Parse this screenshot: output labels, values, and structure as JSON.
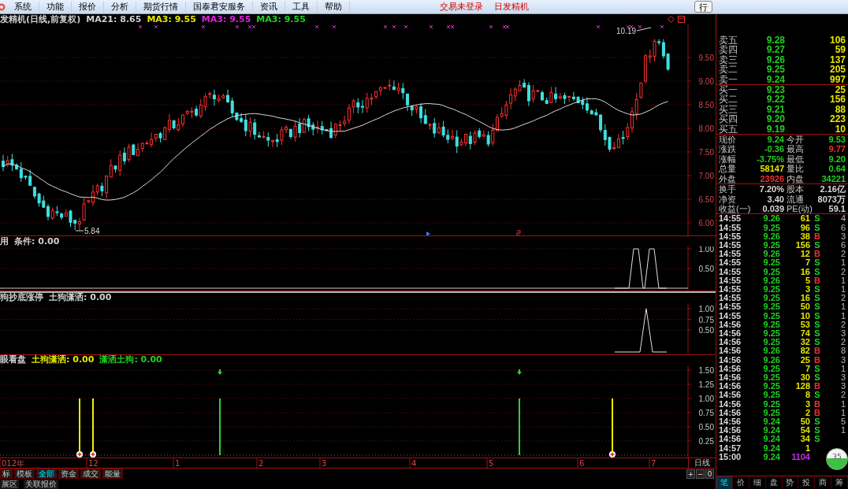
{
  "menu_bar": {
    "items": [
      "系统",
      "功能",
      "报价",
      "分析",
      "期货行情",
      "国泰君安服务",
      "资讯",
      "工具",
      "帮助"
    ],
    "status": [
      "交易未登录",
      "日发精机"
    ],
    "button": "行"
  },
  "main_chart": {
    "legend": [
      {
        "text": "发精机(日线,前复权)",
        "color": "#d0d0d0"
      },
      {
        "text": "MA21: 8.65",
        "color": "#d0d0d0"
      },
      {
        "text": "MA3: 9.55",
        "color": "#e6e600"
      },
      {
        "text": "MA3: 9.55",
        "color": "#e020e0"
      },
      {
        "text": "MA3: 9.55",
        "color": "#20d020"
      }
    ],
    "high_label": "10.19",
    "low_label": "5.84",
    "yticks": [
      "9.50",
      "9.00",
      "8.50",
      "8.00",
      "7.50",
      "7.00",
      "6.50",
      "6.00"
    ]
  },
  "indicator_panels": [
    {
      "legend": [
        {
          "text": "用",
          "color": "#d0d0d0"
        },
        {
          "text": "条件: 0.00",
          "color": "#d0d0d0"
        }
      ],
      "yticks": [
        "1.00",
        "0.50"
      ]
    },
    {
      "legend": [
        {
          "text": "狗抄底涨停",
          "color": "#d0d0d0"
        },
        {
          "text": "土狗潇洒: 0.00",
          "color": "#d0d0d0"
        }
      ],
      "yticks": [
        "1.00",
        "0.75",
        "0.50"
      ]
    },
    {
      "legend": [
        {
          "text": "眼看盘",
          "color": "#d0d0d0"
        },
        {
          "text": "土狗潇洒: 0.00",
          "color": "#e6e600"
        },
        {
          "text": "潇洒土狗: 0.00",
          "color": "#20d020"
        }
      ],
      "yticks": [
        "1.50",
        "1.25",
        "1.00",
        "0.75",
        "0.50",
        "0.25"
      ]
    }
  ],
  "date_axis": {
    "labels": [
      "012年",
      "12",
      "1",
      "2",
      "3",
      "4",
      "5",
      "6",
      "7"
    ],
    "period": "日线"
  },
  "bottom_tabs": [
    {
      "label": "标",
      "selected": false
    },
    {
      "label": "模板",
      "selected": false
    },
    {
      "label": "全部",
      "selected": true
    },
    {
      "label": "资金",
      "selected": false
    },
    {
      "label": "成交",
      "selected": false
    },
    {
      "label": "能量",
      "selected": false
    }
  ],
  "zoom_buttons": [
    "+",
    "−",
    "0"
  ],
  "bottom_links": [
    "展区",
    "关联报价"
  ],
  "order_book": {
    "asks": [
      {
        "label": "卖五",
        "price": "9.28",
        "volume": "106"
      },
      {
        "label": "卖四",
        "price": "9.27",
        "volume": "59"
      },
      {
        "label": "卖三",
        "price": "9.26",
        "volume": "137"
      },
      {
        "label": "卖二",
        "price": "9.25",
        "volume": "205"
      },
      {
        "label": "卖一",
        "price": "9.24",
        "volume": "997"
      }
    ],
    "bids": [
      {
        "label": "买一",
        "price": "9.23",
        "volume": "25"
      },
      {
        "label": "买二",
        "price": "9.22",
        "volume": "156"
      },
      {
        "label": "买三",
        "price": "9.21",
        "volume": "88"
      },
      {
        "label": "买四",
        "price": "9.20",
        "volume": "223"
      },
      {
        "label": "买五",
        "price": "9.19",
        "volume": "10"
      }
    ]
  },
  "quote": [
    {
      "label": "现价",
      "value": "9.24",
      "color": "#20d020"
    },
    {
      "label": "今开",
      "value": "9.53",
      "color": "#20d020"
    },
    {
      "label": "涨跌",
      "value": "-0.36",
      "color": "#20d020"
    },
    {
      "label": "最高",
      "value": "9.77",
      "color": "#f03030"
    },
    {
      "label": "涨幅",
      "value": "-3.75%",
      "color": "#20d020"
    },
    {
      "label": "最低",
      "value": "9.20",
      "color": "#20d020"
    },
    {
      "label": "总量",
      "value": "58147",
      "color": "#e6e600"
    },
    {
      "label": "量比",
      "value": "0.64",
      "color": "#20d020"
    },
    {
      "label": "外盘",
      "value": "23926",
      "color": "#f03030"
    },
    {
      "label": "内盘",
      "value": "34221",
      "color": "#20d020"
    }
  ],
  "fundamentals": [
    {
      "label": "换手",
      "value": "7.20%"
    },
    {
      "label": "股本",
      "value": "2.16亿"
    },
    {
      "label": "净资",
      "value": "3.40"
    },
    {
      "label": "流通",
      "value": "8073万"
    },
    {
      "label": "收益(一)",
      "value": "0.039"
    },
    {
      "label": "PE(动)",
      "value": "59.1"
    }
  ],
  "trades": [
    {
      "kind": "trade",
      "time": "14:55",
      "price": "9.26",
      "volume": "61",
      "side": "S",
      "color": "#20d020",
      "count": "4"
    },
    {
      "kind": "trade",
      "time": "14:55",
      "price": "9.25",
      "volume": "96",
      "side": "S",
      "color": "#20d020",
      "count": "6"
    },
    {
      "kind": "trade",
      "time": "14:55",
      "price": "9.26",
      "volume": "38",
      "side": "B",
      "color": "#f03030",
      "count": "3"
    },
    {
      "kind": "trade",
      "time": "14:55",
      "price": "9.25",
      "volume": "156",
      "side": "S",
      "color": "#20d020",
      "count": "6"
    },
    {
      "kind": "trade",
      "time": "14:55",
      "price": "9.26",
      "volume": "12",
      "side": "B",
      "color": "#f03030",
      "count": "2"
    },
    {
      "kind": "trade",
      "time": "14:55",
      "price": "9.25",
      "volume": "7",
      "side": "S",
      "color": "#20d020",
      "count": "1"
    },
    {
      "kind": "trade",
      "time": "14:55",
      "price": "9.25",
      "volume": "16",
      "side": "S",
      "color": "#20d020",
      "count": "2"
    },
    {
      "kind": "trade",
      "time": "14:55",
      "price": "9.26",
      "volume": "5",
      "side": "B",
      "color": "#f03030",
      "count": "1"
    },
    {
      "kind": "trade",
      "time": "14:55",
      "price": "9.25",
      "volume": "3",
      "side": "S",
      "color": "#20d020",
      "count": "1"
    },
    {
      "kind": "trade",
      "time": "14:55",
      "price": "9.25",
      "volume": "16",
      "side": "S",
      "color": "#20d020",
      "count": "2"
    },
    {
      "kind": "trade",
      "time": "14:55",
      "price": "9.25",
      "volume": "50",
      "side": "S",
      "color": "#20d020",
      "count": "1"
    },
    {
      "kind": "trade",
      "time": "14:55",
      "price": "9.25",
      "volume": "10",
      "side": "S",
      "color": "#20d020",
      "count": "1"
    },
    {
      "kind": "trade",
      "time": "14:56",
      "price": "9.25",
      "volume": "53",
      "side": "S",
      "color": "#20d020",
      "count": "2"
    },
    {
      "kind": "trade",
      "time": "14:56",
      "price": "9.25",
      "volume": "74",
      "side": "S",
      "color": "#20d020",
      "count": "3"
    },
    {
      "kind": "trade",
      "time": "14:56",
      "price": "9.25",
      "volume": "32",
      "side": "S",
      "color": "#20d020",
      "count": "2"
    },
    {
      "kind": "trade",
      "time": "14:56",
      "price": "9.26",
      "volume": "82",
      "side": "B",
      "color": "#f03030",
      "count": "8"
    },
    {
      "kind": "trade",
      "time": "14:56",
      "price": "9.26",
      "volume": "25",
      "side": "B",
      "color": "#f03030",
      "count": "3"
    },
    {
      "kind": "trade",
      "time": "14:56",
      "price": "9.25",
      "volume": "7",
      "side": "S",
      "color": "#20d020",
      "count": "1"
    },
    {
      "kind": "trade",
      "time": "14:56",
      "price": "9.25",
      "volume": "30",
      "side": "S",
      "color": "#20d020",
      "count": "3"
    },
    {
      "kind": "trade",
      "time": "14:56",
      "price": "9.25",
      "volume": "128",
      "side": "B",
      "color": "#f03030",
      "count": "3"
    },
    {
      "kind": "trade",
      "time": "14:56",
      "price": "9.25",
      "volume": "8",
      "side": "S",
      "color": "#20d020",
      "count": "2"
    },
    {
      "kind": "trade",
      "time": "14:56",
      "price": "9.25",
      "volume": "3",
      "side": "B",
      "color": "#f03030",
      "count": "1"
    },
    {
      "kind": "trade",
      "time": "14:56",
      "price": "9.25",
      "volume": "2",
      "side": "B",
      "color": "#f03030",
      "count": "1"
    },
    {
      "kind": "trade",
      "time": "14:56",
      "price": "9.24",
      "volume": "50",
      "side": "S",
      "color": "#20d020",
      "count": "5"
    },
    {
      "kind": "trade",
      "time": "14:56",
      "price": "9.24",
      "volume": "54",
      "side": "S",
      "color": "#20d020",
      "count": "1"
    },
    {
      "kind": "trade",
      "time": "14:56",
      "price": "9.24",
      "volume": "34",
      "side": "S",
      "color": "#20d020"
    },
    {
      "kind": "trade",
      "time": "14:57",
      "price": "9.24",
      "volume": "1"
    },
    {
      "kind": "total",
      "time": "15:00",
      "price": "9.24",
      "volume": "1104"
    }
  ],
  "side_tabs": [
    {
      "label": "笔",
      "selected": true
    },
    {
      "label": "价",
      "selected": false
    },
    {
      "label": "细",
      "selected": false
    },
    {
      "label": "盘",
      "selected": false
    },
    {
      "label": "势",
      "selected": false
    },
    {
      "label": "投",
      "selected": false
    },
    {
      "label": "商",
      "selected": false
    },
    {
      "label": "筹",
      "selected": false
    }
  ],
  "speed_badge": "35"
}
